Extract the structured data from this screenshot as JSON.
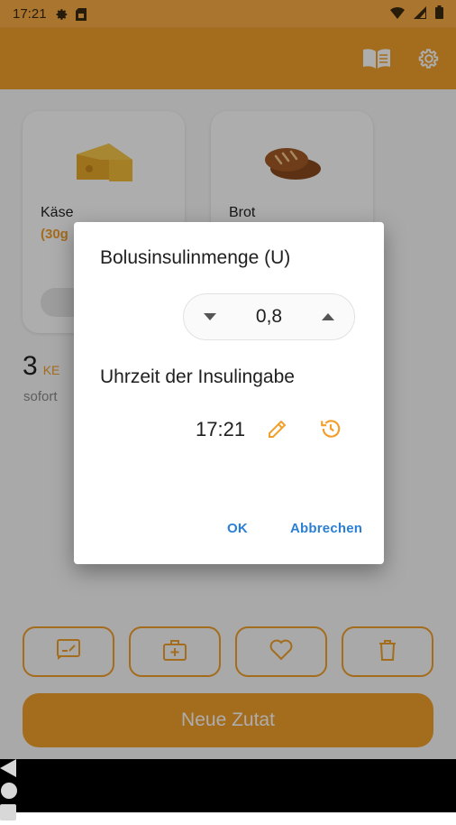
{
  "status_bar": {
    "time": "17:21",
    "icons": [
      "settings-icon",
      "sim-card-icon",
      "wifi-icon",
      "signal-icon",
      "battery-icon"
    ]
  },
  "app_bar": {
    "actions": [
      "book-icon",
      "settings-icon"
    ]
  },
  "background": {
    "cards": [
      {
        "name": "Käse",
        "amount": "(30g",
        "icon": "cheese-icon"
      },
      {
        "name": "Brot",
        "icon": "bread-icon"
      }
    ],
    "ke_value": "3",
    "ke_unit": "KE",
    "timing": "sofort",
    "toolbar": [
      "edit-note-icon",
      "medical-kit-icon",
      "heart-icon",
      "trash-icon"
    ],
    "new_button_label": "Neue Zutat"
  },
  "dialog": {
    "title": "Bolusinsulinmenge (U)",
    "stepper_value": "0,8",
    "time_title": "Uhrzeit der Insulingabe",
    "time_value": "17:21",
    "ok_label": "OK",
    "cancel_label": "Abbrechen"
  },
  "colors": {
    "status_bar": "#fbad45",
    "primary": "#f29f2c",
    "dialog_button": "#2a7fd4"
  }
}
